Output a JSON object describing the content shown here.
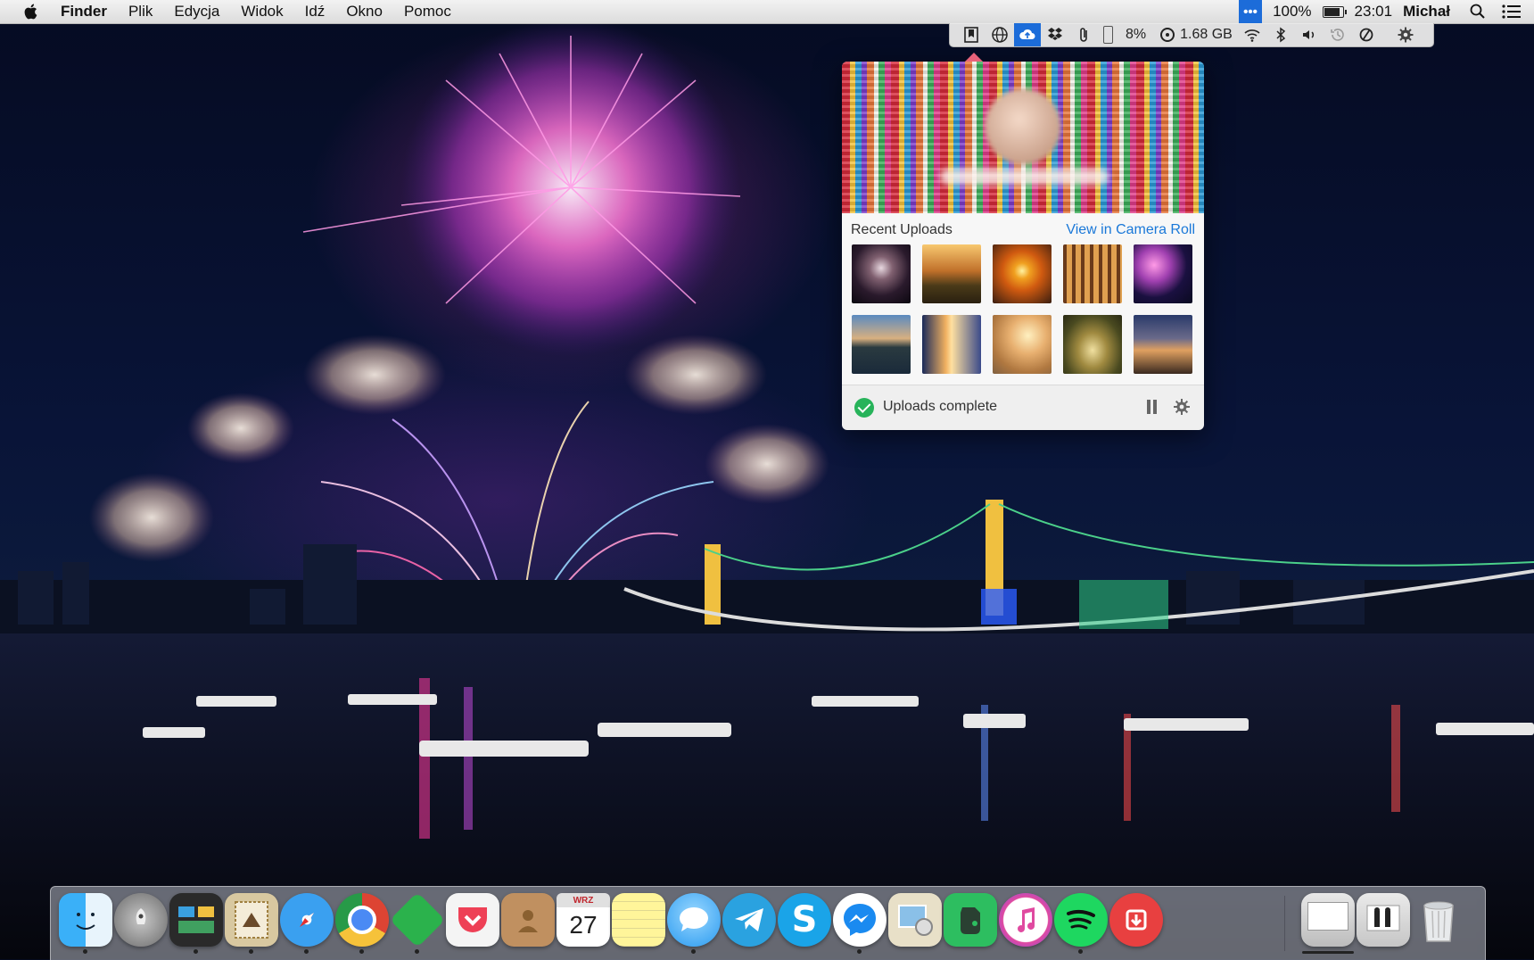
{
  "menubar": {
    "app_name": "Finder",
    "menus": [
      "Plik",
      "Edycja",
      "Widok",
      "Idź",
      "Okno",
      "Pomoc"
    ],
    "status_ellipsis": "•••",
    "battery_percent": "100%",
    "time": "23:01",
    "user": "Michał",
    "icons": [
      "apple-icon",
      "battery-icon",
      "spotlight-icon",
      "notification-center-icon"
    ]
  },
  "tray": {
    "cpu_percent": "8%",
    "memory": "1.68 GB",
    "icons": [
      "bookmark-icon",
      "globe-icon",
      "cloud-upload-icon",
      "dropbox-icon",
      "paperclip-icon",
      "battery-icon",
      "disk-icon",
      "wifi-icon",
      "bluetooth-icon",
      "volume-icon",
      "time-machine-icon",
      "disable-icon",
      "gear-icon"
    ]
  },
  "popover": {
    "section_title": "Recent Uploads",
    "view_link": "View in Camera Roll",
    "status_text": "Uploads complete",
    "colors": {
      "link": "#1a78d8",
      "success": "#27b35a"
    }
  },
  "dock": {
    "apps": [
      "Finder",
      "Launchpad",
      "Mission Control",
      "Mail",
      "Safari",
      "Chrome",
      "Feedly",
      "Pocket",
      "Contacts",
      "Calendar",
      "Notes",
      "Messages",
      "Telegram",
      "Skype",
      "Messenger",
      "Preview",
      "Evernote",
      "iTunes",
      "Spotify",
      "Transmit",
      "Applications",
      "Documents",
      "Trash"
    ],
    "calendar_month": "WRZ",
    "calendar_day": "27"
  }
}
